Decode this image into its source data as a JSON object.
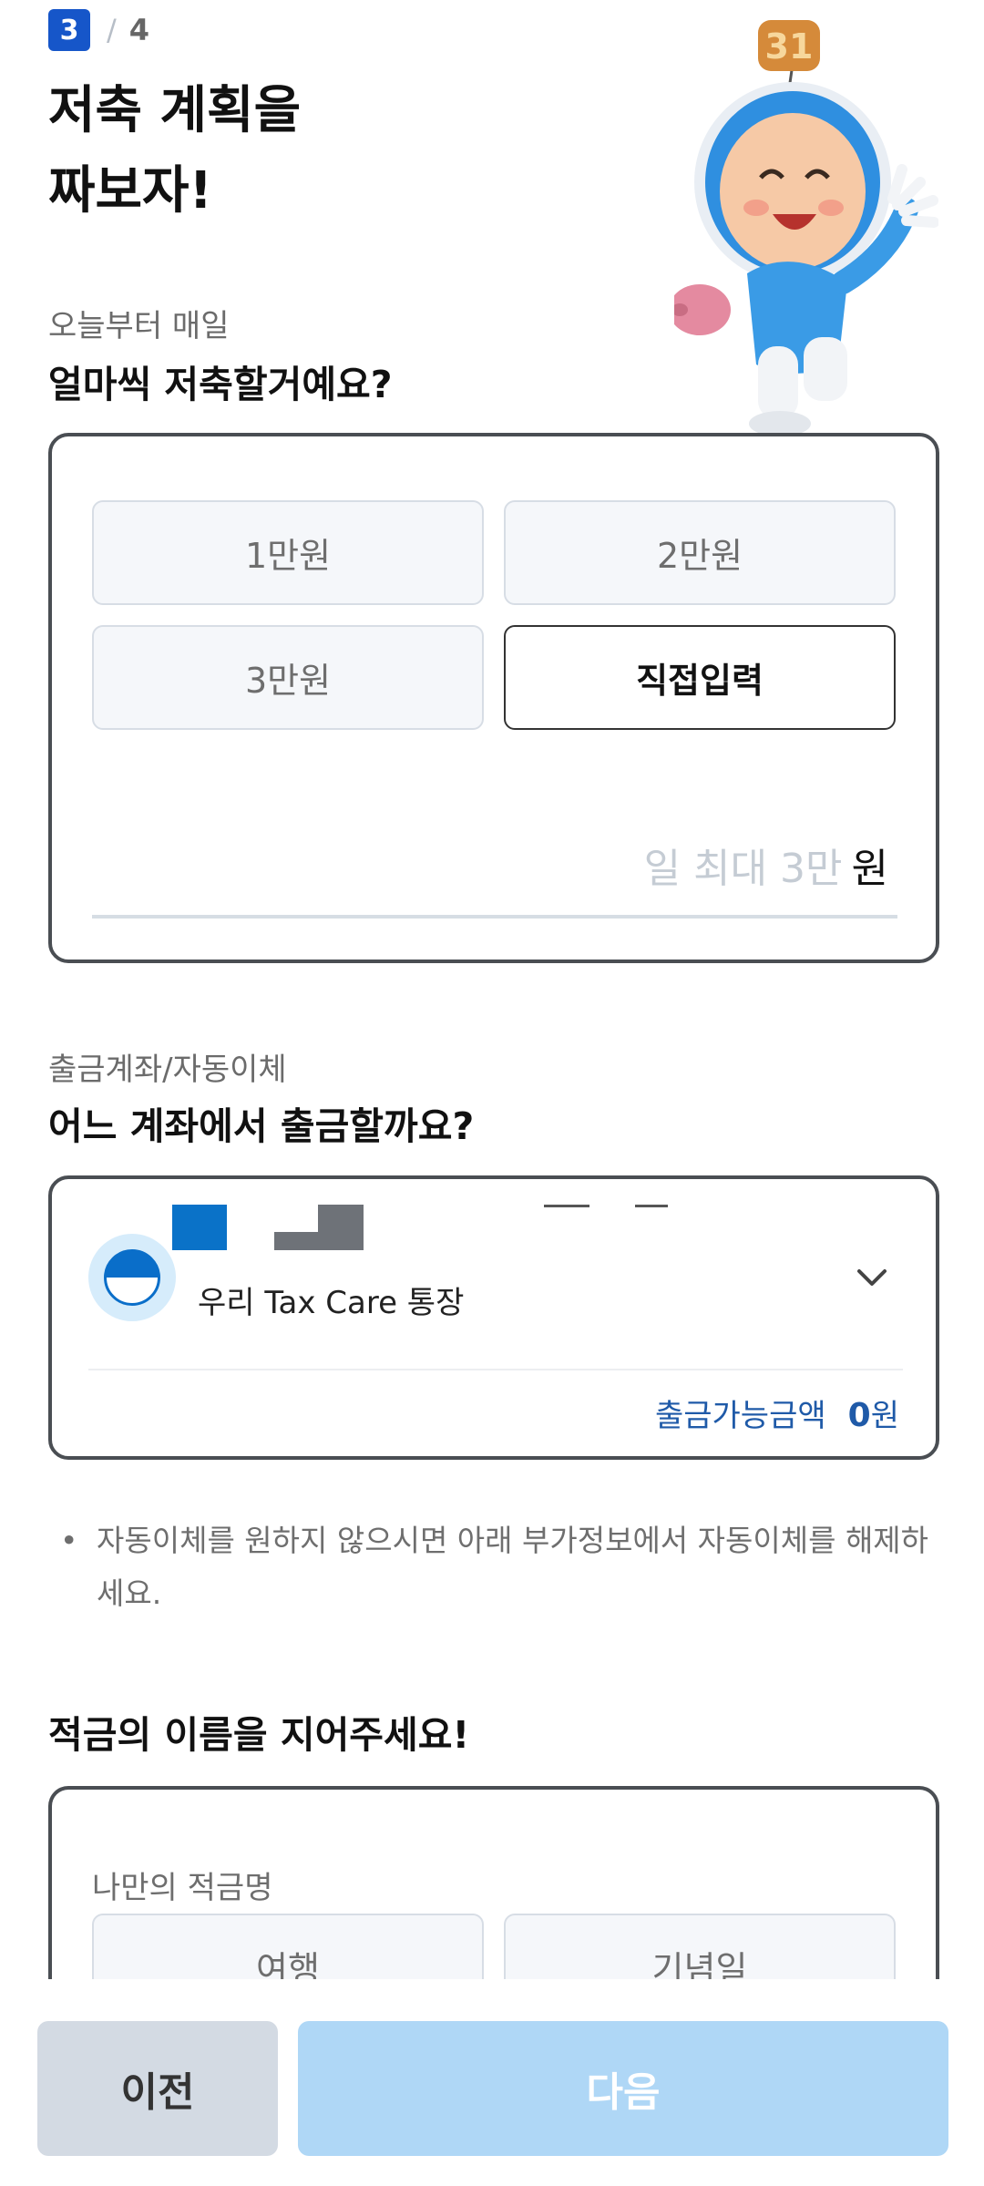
{
  "header": {
    "step_current": "3",
    "step_separator": "/",
    "step_total": "4",
    "title_line1": "저축 계획을",
    "title_line2": "짜보자!"
  },
  "amount_section": {
    "sub_label": "오늘부터 매일",
    "question": "얼마씩 저축할거예요?",
    "options": [
      "1만원",
      "2만원",
      "3만원",
      "직접입력"
    ],
    "selected": "직접입력",
    "input_placeholder": "일 최대 3만",
    "input_unit": "원"
  },
  "account_section": {
    "sub_label": "출금계좌/자동이체",
    "question": "어느 계좌에서 출금할까요?",
    "account_name": "우리 Tax Care 통장",
    "balance_label": "출금가능금액",
    "balance_value": "0",
    "balance_unit": "원",
    "notice_bullet": "•",
    "notice_text": "자동이체를 원하지 않으시면 아래 부가정보에서 자동이체를 해제하세요."
  },
  "name_section": {
    "question": "적금의 이름을 지어주세요!",
    "card_label": "나만의 적금명",
    "options": [
      "여행",
      "기념일"
    ]
  },
  "footer": {
    "prev_label": "이전",
    "next_label": "다음"
  },
  "colors": {
    "accent": "#1656c9",
    "next_disabled": "#afd7f6",
    "prev_bg": "#d3dae3",
    "balance_text": "#1f5aa8"
  }
}
